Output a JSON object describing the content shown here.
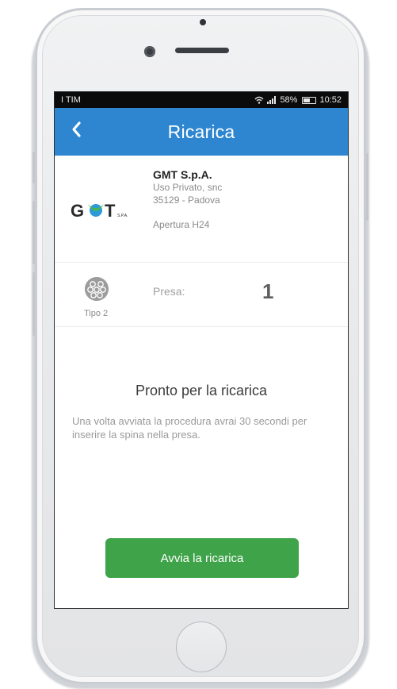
{
  "status_bar": {
    "carrier": "I TIM",
    "battery_percent": "58%",
    "time": "10:52"
  },
  "nav": {
    "title": "Ricarica",
    "back_icon": "chevron-left-icon"
  },
  "station": {
    "logo_text": "GMT",
    "logo_suffix": "S.P.A.",
    "name": "GMT S.p.A.",
    "address_line1": "Uso Privato, snc",
    "address_line2": "35129 - Padova",
    "hours": "Apertura H24"
  },
  "connector": {
    "icon": "type2-plug-icon",
    "type": "Tipo 2",
    "label": "Presa:",
    "number": "1"
  },
  "message": {
    "title": "Pronto per la ricarica",
    "body": "Una volta avviata la procedura avrai 30 secondi per inserire la spina nella presa."
  },
  "actions": {
    "start_label": "Avvia la ricarica"
  },
  "colors": {
    "navbar": "#2d86cf",
    "start_button": "#3ea349",
    "logo_green": "#49b64e",
    "logo_blue": "#2d9ad8"
  }
}
